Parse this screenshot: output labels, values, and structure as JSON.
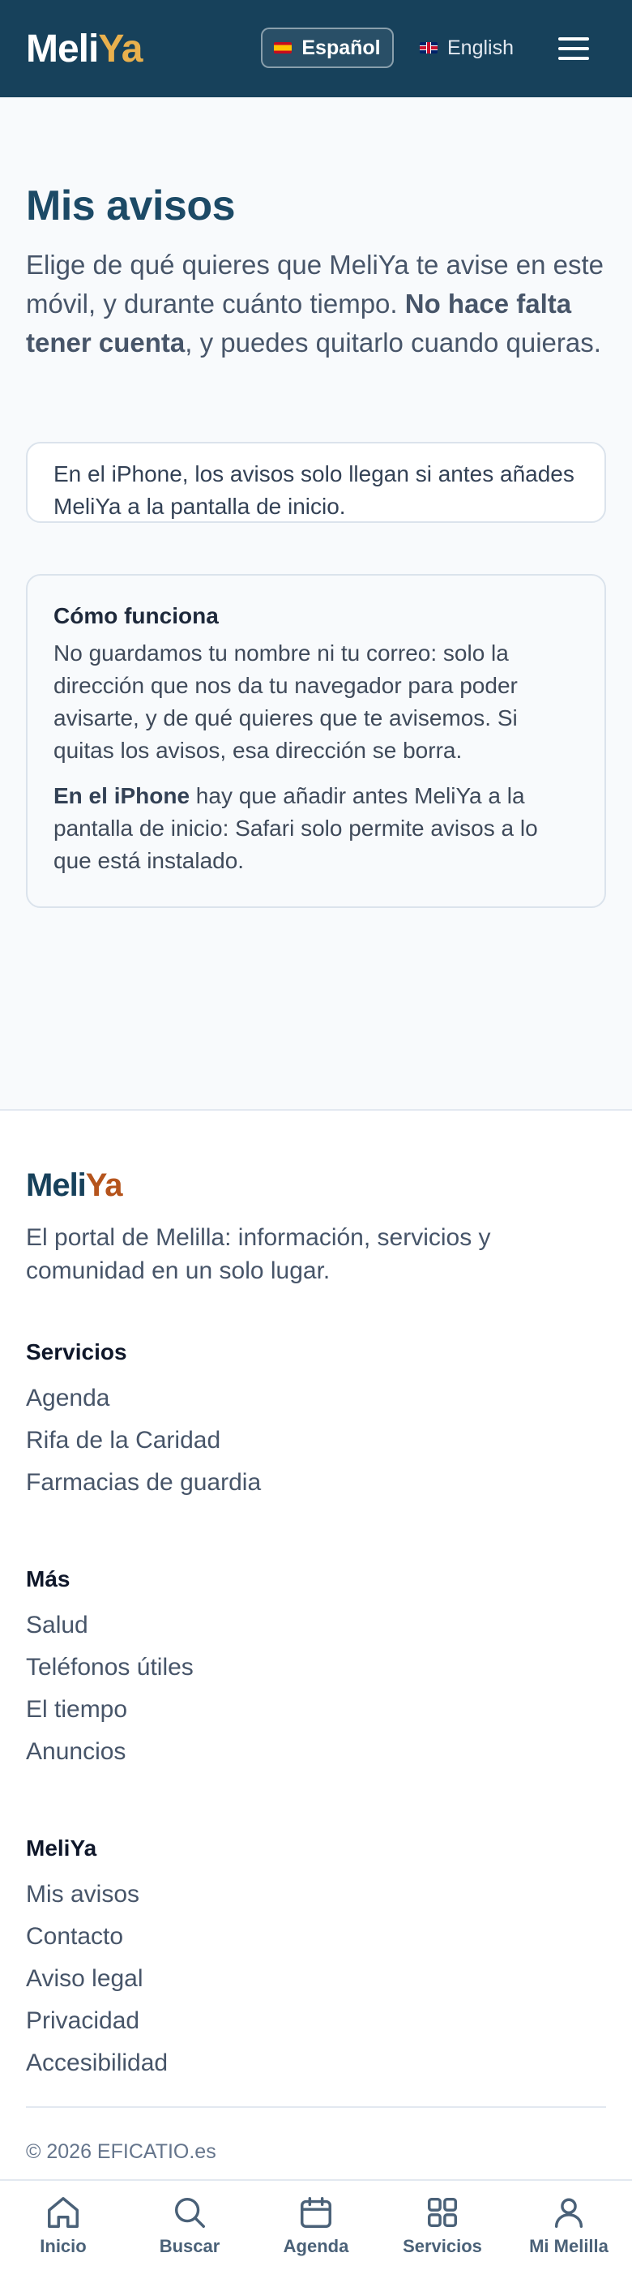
{
  "header": {
    "logo_part1": "Meli",
    "logo_part2": "Ya",
    "lang_es": "Español",
    "lang_en": "English",
    "flag_es_icon": "spain-flag-icon",
    "flag_en_icon": "uk-flag-icon",
    "menu_icon": "hamburger-menu-icon"
  },
  "main": {
    "title": "Mis avisos",
    "intro_a": "Elige de qué quieres que MeliYa te avise en este móvil, y durante cuánto tiempo. ",
    "intro_bold": "No hace falta tener cuenta",
    "intro_b": ", y puedes quitarlo cuando quieras.",
    "notice": "En el iPhone, los avisos solo llegan si antes añades MeliYa a la pantalla de inicio.",
    "how": {
      "title": "Cómo funciona",
      "p1": "No guardamos tu nombre ni tu correo: solo la dirección que nos da tu navegador para poder avisarte, y de qué quieres que te avisemos. Si quitas los avisos, esa dirección se borra.",
      "p2_bold": "En el iPhone",
      "p2_rest": " hay que añadir antes MeliYa a la pantalla de inicio: Safari solo permite avisos a lo que está instalado."
    }
  },
  "footer": {
    "logo_part1": "Meli",
    "logo_part2": "Ya",
    "tagline": "El portal de Melilla: información, servicios y comunidad en un solo lugar.",
    "sections": [
      {
        "heading": "Servicios",
        "links": [
          "Agenda",
          "Rifa de la Caridad",
          "Farmacias de guardia"
        ]
      },
      {
        "heading": "Más",
        "links": [
          "Salud",
          "Teléfonos útiles",
          "El tiempo",
          "Anuncios"
        ]
      },
      {
        "heading": "MeliYa",
        "links": [
          "Mis avisos",
          "Contacto",
          "Aviso legal",
          "Privacidad",
          "Accesibilidad"
        ]
      }
    ],
    "copyright": "© 2026 EFICATIO.es"
  },
  "bottom_nav": [
    {
      "label": "Inicio",
      "icon": "home-icon"
    },
    {
      "label": "Buscar",
      "icon": "search-icon"
    },
    {
      "label": "Agenda",
      "icon": "calendar-icon"
    },
    {
      "label": "Servicios",
      "icon": "grid-icon"
    },
    {
      "label": "Mi Melilla",
      "icon": "user-icon"
    }
  ],
  "colors": {
    "header_bg": "#17415b",
    "logo_accent": "#e9b04d",
    "footer_logo_accent": "#b5541c",
    "title": "#1c4a66"
  }
}
